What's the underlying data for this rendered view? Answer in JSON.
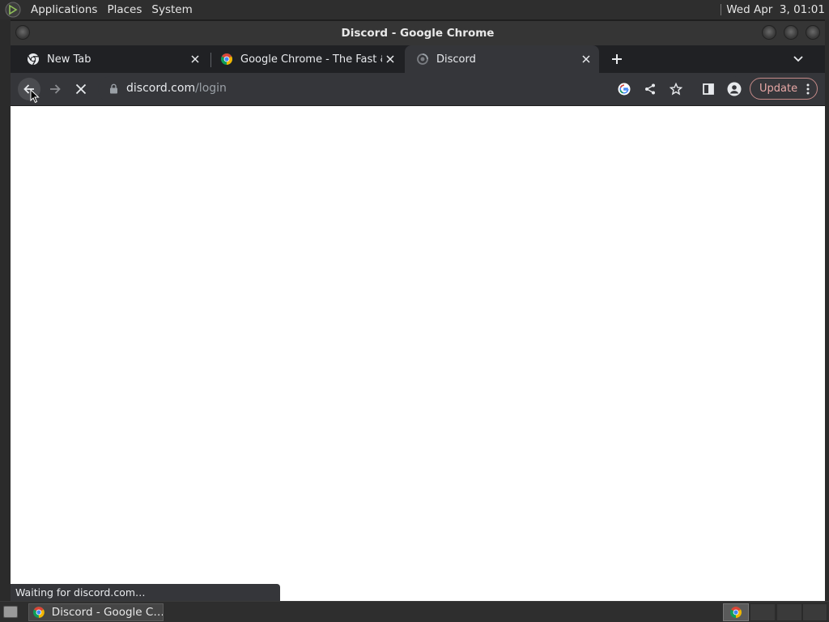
{
  "top_panel": {
    "menus": [
      "Applications",
      "Places",
      "System"
    ],
    "clock": "Wed Apr  3, 01:01"
  },
  "window": {
    "title": "Discord - Google Chrome"
  },
  "tabs": [
    {
      "label": "New Tab",
      "icon": "chrome-icon"
    },
    {
      "label": "Google Chrome - The Fast & Secure Web Browser",
      "icon": "chrome-color-icon"
    },
    {
      "label": "Discord",
      "icon": "loading-icon",
      "active": true
    }
  ],
  "toolbar": {
    "url_host": "discord.com",
    "url_path": "/login",
    "update_label": "Update"
  },
  "status": {
    "text": "Waiting for discord.com…"
  },
  "taskbar": {
    "task_label": "Discord - Google C…"
  },
  "colors": {
    "tab_strip": "#202124",
    "toolbar": "#35363a",
    "update_accent": "#e8a8a6",
    "content": "#ffffff"
  }
}
